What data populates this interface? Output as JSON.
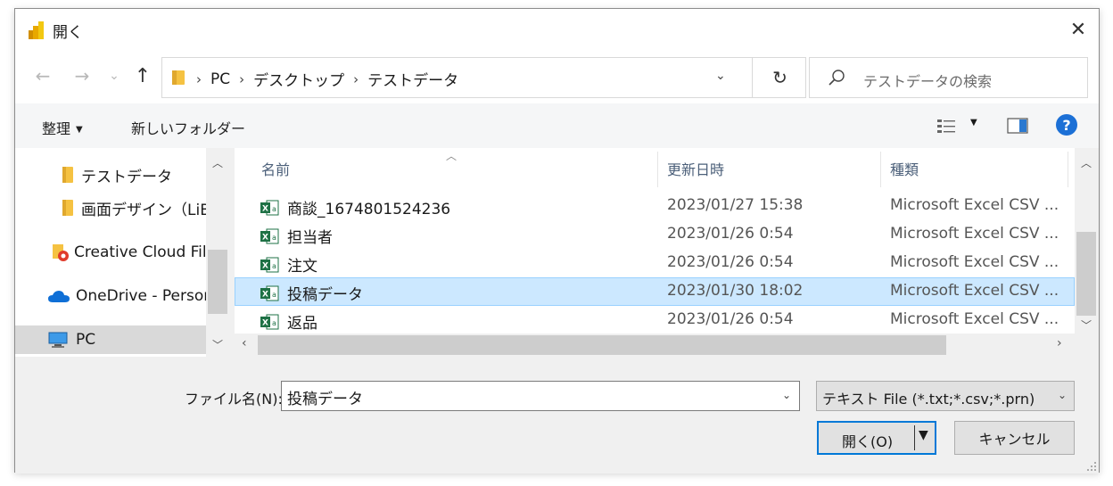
{
  "window": {
    "title": "開く",
    "close_glyph": "✕"
  },
  "nav": {
    "back": "←",
    "forward": "→",
    "recent": "⌄",
    "up": "↑",
    "breadcrumbs": [
      "PC",
      "デスクトップ",
      "テストデータ"
    ],
    "separator": "›",
    "refresh": "↻",
    "dropdown": "⌄"
  },
  "search": {
    "placeholder": "テストデータの検索"
  },
  "toolbar": {
    "organize": "整理",
    "organize_caret": "▼",
    "new_folder": "新しいフォルダー",
    "view_caret": "▼",
    "help": "?"
  },
  "sidebar": {
    "items": [
      {
        "label": "テストデータ",
        "icon": "folder-icon"
      },
      {
        "label": "画面デザイン（LiB",
        "icon": "folder-icon"
      },
      {
        "label": "Creative Cloud File",
        "icon": "creative-cloud-icon"
      },
      {
        "label": "OneDrive - Person",
        "icon": "onedrive-icon"
      },
      {
        "label": "PC",
        "icon": "pc-icon"
      }
    ],
    "scroll_up": "︿",
    "scroll_down": "﹀"
  },
  "columns": {
    "name": "名前",
    "date": "更新日時",
    "type": "種類",
    "sort_caret": "︿"
  },
  "files": [
    {
      "name": "商談_1674801524236",
      "date": "2023/01/27 15:38",
      "type": "Microsoft Excel CSV ...",
      "selected": false
    },
    {
      "name": "担当者",
      "date": "2023/01/26 0:54",
      "type": "Microsoft Excel CSV ...",
      "selected": false
    },
    {
      "name": "注文",
      "date": "2023/01/26 0:54",
      "type": "Microsoft Excel CSV ...",
      "selected": false
    },
    {
      "name": "投稿データ",
      "date": "2023/01/30 18:02",
      "type": "Microsoft Excel CSV ...",
      "selected": true
    },
    {
      "name": "返品",
      "date": "2023/01/26 0:54",
      "type": "Microsoft Excel CSV ...",
      "selected": false
    }
  ],
  "scroll": {
    "up": "︿",
    "down": "﹀",
    "left": "‹",
    "right": "›"
  },
  "filename": {
    "label": "ファイル名(N):",
    "value": "投稿データ",
    "caret": "⌄"
  },
  "filetype": {
    "value": "テキスト File (*.txt;*.csv;*.prn)",
    "caret": "⌄"
  },
  "buttons": {
    "open": "開く(O)",
    "open_arrow": "▼",
    "cancel": "キャンセル"
  },
  "colors": {
    "accent": "#0078d7",
    "selection": "#cce8ff",
    "excel_green": "#1e7145",
    "folder_yellow": "#f5c242"
  }
}
